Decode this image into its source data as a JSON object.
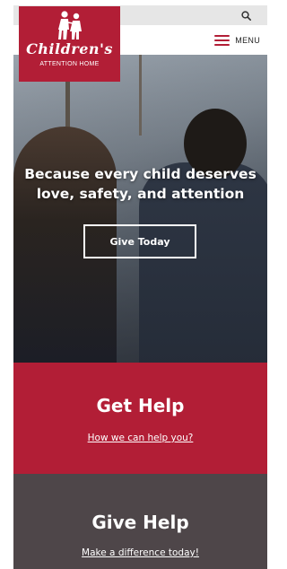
{
  "header": {
    "search_icon": "search-icon",
    "menu_label": "MENU",
    "menu_icon": "hamburger-icon"
  },
  "logo": {
    "script_text": "Children's",
    "subtitle": "ATTENTION HOME",
    "brand_color": "#b21e36"
  },
  "hero": {
    "title": "Because every child deserves love, safety, and attention",
    "button_label": "Give Today"
  },
  "get_help": {
    "title": "Get Help",
    "link": "How we can help you?",
    "color": "#b21e36"
  },
  "give_help": {
    "title": "Give Help",
    "link": "Make a difference today!",
    "color": "#4e4649"
  }
}
